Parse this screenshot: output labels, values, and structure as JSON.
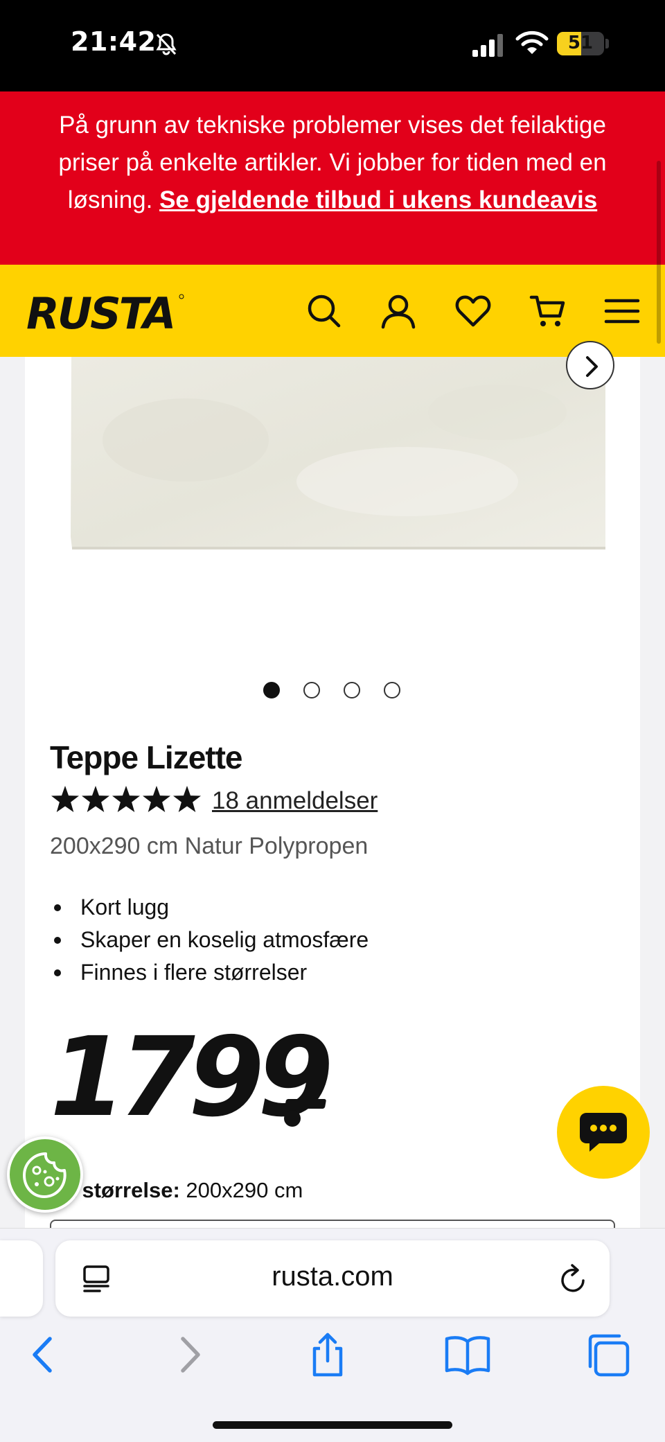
{
  "status_bar": {
    "time": "21:42",
    "battery_level": "51",
    "battery_fraction": 0.51,
    "icons": [
      "bell-slash-icon",
      "signal-icon",
      "wifi-icon",
      "battery-icon"
    ]
  },
  "notice": {
    "text": "På grunn av tekniske problemer vises det feilaktige priser på enkelte artikler. Vi jobber for tiden med en løsning.",
    "link": "Se gjeldende tilbud i ukens kundeavis",
    "background": "#e2001a"
  },
  "header": {
    "logo": "RUSTA",
    "background": "#ffd200",
    "icons": [
      "search-icon",
      "account-icon",
      "heart-icon",
      "cart-icon",
      "menu-icon"
    ]
  },
  "gallery": {
    "image_count": 4,
    "active_index": 0,
    "next_icon": "chevron-right-icon"
  },
  "product": {
    "title": "Teppe Lizette",
    "rating": 5,
    "rating_max": 5,
    "reviews": "18 anmeldelser",
    "subtitle": "200x290 cm Natur Polypropen",
    "features": [
      "Kort lugg",
      "Skaper en koselig atmosfære",
      "Finnes i flere størrelser"
    ],
    "price": "1799",
    "price_suffix": ".-",
    "size_label": "lgt størrelse:",
    "size_value": "200x290 cm"
  },
  "floating": {
    "chat_icon": "chat-bubble-icon",
    "cookie_icon": "cookie-icon"
  },
  "browser": {
    "url": "rusta.com",
    "icons": [
      "reader-icon",
      "reload-icon",
      "back-icon",
      "forward-icon",
      "share-icon",
      "bookmarks-icon",
      "tabs-icon"
    ]
  }
}
